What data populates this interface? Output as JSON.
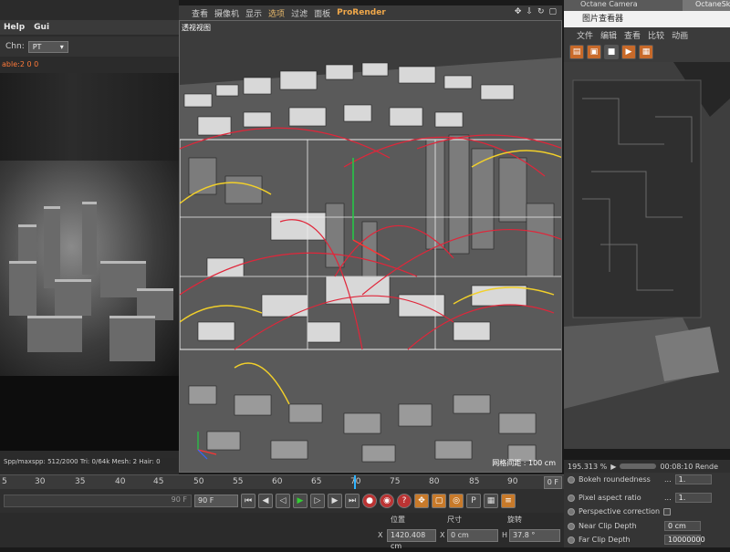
{
  "left_panel": {
    "menu": [
      "Help",
      "Gui"
    ],
    "chn_label": "Chn:",
    "chn_value": "PT",
    "status_line": "able:2  0 0",
    "stats": {
      "spp_label": "Spp/maxspp:",
      "spp_value": "512/2000",
      "tri_label": "Tri:",
      "tri_value": "0/64k",
      "mesh_label": "Mesh:",
      "mesh_value": "2",
      "hair_label": "Hair:",
      "hair_value": "0"
    }
  },
  "viewport": {
    "menu": [
      "查看",
      "摄像机",
      "显示",
      "选项",
      "过滤",
      "面板"
    ],
    "highlighted_menu": "选项",
    "prorender": "ProRender",
    "title": "透视视图",
    "grid_label": "网格间距 : 100 cm",
    "icons": [
      "move-icon",
      "down-arrow-icon",
      "rotate-icon",
      "maximize-icon"
    ]
  },
  "picture_viewer": {
    "tab_label": "Octane Camera",
    "tab2_label": "OctaneSk",
    "title": "图片查看器",
    "menu": [
      "文件",
      "编辑",
      "查看",
      "比较",
      "动画"
    ],
    "zoom": "195.313 %",
    "time": "00:08:10 Rende"
  },
  "attributes": [
    {
      "label": "Bokeh roundedness",
      "value": "1."
    },
    {
      "label": "Pixel aspect ratio",
      "value": "1."
    },
    {
      "label": "Perspective correction",
      "value": ""
    },
    {
      "label": "Near Clip Depth",
      "value": "0 cm"
    },
    {
      "label": "Far Clip Depth",
      "value": "10000000"
    }
  ],
  "timeline": {
    "ticks": [
      "5",
      "30",
      "35",
      "40",
      "45",
      "50",
      "55",
      "60",
      "65",
      "70",
      "75",
      "80",
      "85",
      "90"
    ],
    "current_frame": "0 F"
  },
  "transport": {
    "end_frame_a": "90 F",
    "end_frame_b": "90 F"
  },
  "coordinates": {
    "position_header": "位置",
    "size_header": "尺寸",
    "rotation_header": "旋转",
    "x_label": "X",
    "x_position": "1420.408 cm",
    "x_size": "0 cm",
    "h_label": "H",
    "h_rotation": "37.8 °"
  },
  "colors": {
    "accent_orange": "#f0a84a",
    "playhead_blue": "#2fb3ff",
    "spline_red": "#e0263a",
    "spline_yellow": "#f2d02a"
  }
}
